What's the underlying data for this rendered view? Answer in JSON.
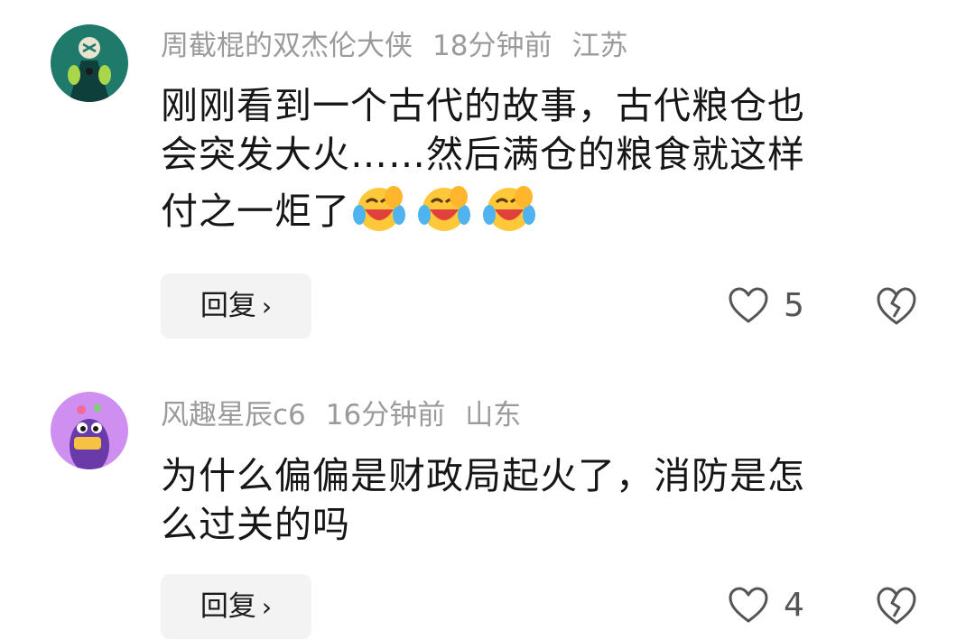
{
  "comments": [
    {
      "username": "周截棍的双杰伦大侠",
      "time": "18分钟前",
      "location": "江苏",
      "lines": [
        "刚刚看到一个古代的故事，古代粮仓也",
        "会突发大火……然后满仓的粮食就这样",
        "付之一炬了"
      ],
      "trailing_emoji": [
        "laughing-crying-emoji",
        "laughing-crying-emoji",
        "laughing-crying-emoji"
      ],
      "reply_label": "回复",
      "likes": "5",
      "avatar_icon": "avatar-green-character",
      "accent": "#1f7a6b"
    },
    {
      "username": "风趣星辰c6",
      "time": "16分钟前",
      "location": "山东",
      "lines": [
        "为什么偏偏是财政局起火了，消防是怎",
        "么过关的吗"
      ],
      "reply_label": "回复",
      "likes": "4",
      "avatar_icon": "avatar-purple-monster",
      "accent": "#cf8ff0"
    }
  ],
  "icons": {
    "reply_chevron": "chevron-right-icon",
    "like": "heart-outline-icon",
    "dislike": "broken-heart-icon"
  },
  "colors": {
    "meta_text": "#9b9b9b",
    "body_text": "#161616",
    "reply_bg": "#f3f3f3",
    "icon_stroke": "#555555"
  }
}
